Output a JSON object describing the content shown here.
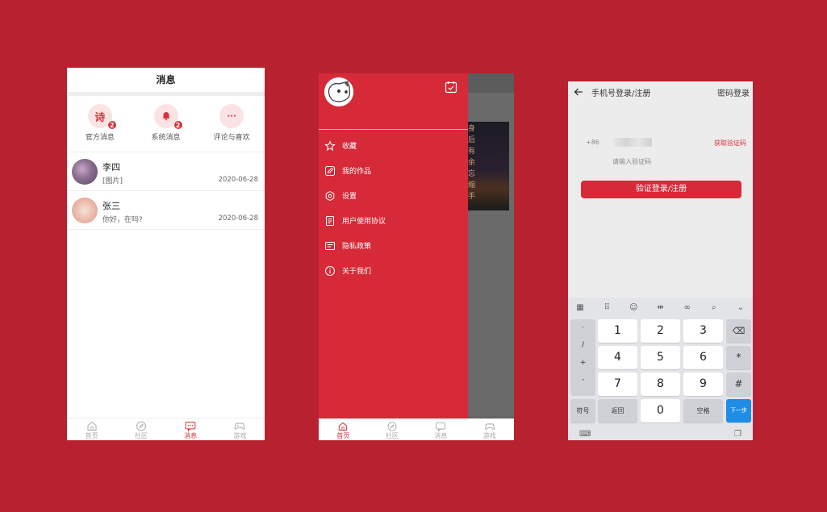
{
  "messages_screen": {
    "title": "消息",
    "categories": [
      {
        "label": "官方消息",
        "icon_text": "诗",
        "badge": "2"
      },
      {
        "label": "系统消息",
        "icon_text": "",
        "badge": "2"
      },
      {
        "label": "评论与喜欢",
        "icon_text": "···",
        "badge": ""
      }
    ],
    "conversations": [
      {
        "name": "李四",
        "preview": "[图片]",
        "date": "2020-06-28"
      },
      {
        "name": "张三",
        "preview": "你好，在吗?",
        "date": "2020-06-28"
      }
    ],
    "tabs": [
      {
        "label": "首页",
        "icon": "home-icon"
      },
      {
        "label": "社区",
        "icon": "compass-icon"
      },
      {
        "label": "消息",
        "icon": "message-icon"
      },
      {
        "label": "游戏",
        "icon": "gamepad-icon"
      }
    ],
    "active_tab": "消息"
  },
  "drawer_screen": {
    "menu": [
      {
        "label": "收藏",
        "icon": "star-icon"
      },
      {
        "label": "我的作品",
        "icon": "edit-icon"
      },
      {
        "label": "设置",
        "icon": "settings-icon"
      },
      {
        "label": "用户使用协议",
        "icon": "agreement-icon"
      },
      {
        "label": "隐私政策",
        "icon": "privacy-icon"
      },
      {
        "label": "关于我们",
        "icon": "info-icon"
      }
    ],
    "background_poem_chars": "身后有余忘缩手",
    "tabs": [
      {
        "label": "首页",
        "icon": "home-icon"
      },
      {
        "label": "社区",
        "icon": "compass-icon"
      },
      {
        "label": "消息",
        "icon": "message-icon"
      },
      {
        "label": "游戏",
        "icon": "gamepad-icon"
      }
    ],
    "active_tab": "首页"
  },
  "login_screen": {
    "title": "手机号登录/注册",
    "password_login_link": "密码登录",
    "country_code": "+86",
    "get_code_label": "获取验证码",
    "code_placeholder": "请输入验证码",
    "submit_label": "验证登录/注册",
    "keyboard": {
      "keys": [
        "1",
        "2",
        "3",
        "4",
        "5",
        "6",
        "7",
        "8",
        "9",
        "0"
      ],
      "symbol_keys": [
        "·",
        "/",
        "+",
        "-"
      ],
      "star": "*",
      "hash": "#",
      "symbols_label": "符号",
      "back_label": "返回",
      "space_label": "空格",
      "next_label": "下一步"
    }
  },
  "colors": {
    "background": "#b82230",
    "accent": "#d62a39",
    "key_blue": "#1e8de6"
  }
}
